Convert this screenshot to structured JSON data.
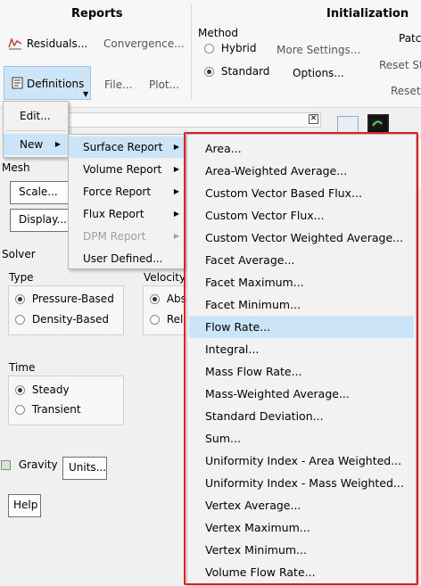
{
  "ribbon": {
    "reports_title": "Reports",
    "initialization_title": "Initialization",
    "residuals_label": "Residuals...",
    "convergence_label": "Convergence...",
    "definitions_label": "Definitions",
    "file_label": "File...",
    "plots_label": "Plot...",
    "method_label": "Method",
    "hybrid_label": "Hybrid",
    "standard_label": "Standard",
    "more_settings_label": "More Settings...",
    "options_label": "Options...",
    "patch_label": "Patc",
    "reset_stats_label": "Reset St",
    "reset_label": "Reset",
    "method_selected": "Standard"
  },
  "definitions_menu": {
    "edit_label": "Edit...",
    "new_label": "New"
  },
  "new_submenu": {
    "items": [
      {
        "label": "Surface Report",
        "has_arrow": true,
        "disabled": false,
        "highlighted": true
      },
      {
        "label": "Volume Report",
        "has_arrow": true,
        "disabled": false,
        "highlighted": false
      },
      {
        "label": "Force Report",
        "has_arrow": true,
        "disabled": false,
        "highlighted": false
      },
      {
        "label": "Flux Report",
        "has_arrow": true,
        "disabled": false,
        "highlighted": false
      },
      {
        "label": "DPM Report",
        "has_arrow": true,
        "disabled": true,
        "highlighted": false
      },
      {
        "label": "User Defined...",
        "has_arrow": false,
        "disabled": false,
        "highlighted": false
      }
    ]
  },
  "surface_report_menu": {
    "highlight_color": "#cce4f7",
    "border_color": "#e02020",
    "items": [
      {
        "label": "Area..."
      },
      {
        "label": "Area-Weighted Average..."
      },
      {
        "label": "Custom Vector Based Flux..."
      },
      {
        "label": "Custom Vector Flux..."
      },
      {
        "label": "Custom Vector Weighted Average..."
      },
      {
        "label": "Facet Average..."
      },
      {
        "label": "Facet Maximum..."
      },
      {
        "label": "Facet Minimum..."
      },
      {
        "label": "Flow Rate...",
        "highlighted": true
      },
      {
        "label": "Integral..."
      },
      {
        "label": "Mass Flow Rate..."
      },
      {
        "label": "Mass-Weighted Average..."
      },
      {
        "label": "Standard Deviation..."
      },
      {
        "label": "Sum..."
      },
      {
        "label": "Uniformity Index - Area Weighted..."
      },
      {
        "label": "Uniformity Index - Mass Weighted..."
      },
      {
        "label": "Vertex Average..."
      },
      {
        "label": "Vertex Maximum..."
      },
      {
        "label": "Vertex Minimum..."
      },
      {
        "label": "Volume Flow Rate..."
      }
    ]
  },
  "panel": {
    "mesh_label": "Mesh",
    "scale_label": "Scale...",
    "display_label": "Display...",
    "solver_label": "Solver",
    "type_label": "Type",
    "pressure_based_label": "Pressure-Based",
    "density_based_label": "Density-Based",
    "velocity_label": "Velocity",
    "absolute_label": "Abs",
    "relative_label": "Rel",
    "time_label": "Time",
    "steady_label": "Steady",
    "transient_label": "Transient",
    "gravity_label": "Gravity",
    "units_label": "Units...",
    "help_label": "Help",
    "type_selected": "Pressure-Based",
    "time_selected": "Steady",
    "gravity_checked": false
  }
}
